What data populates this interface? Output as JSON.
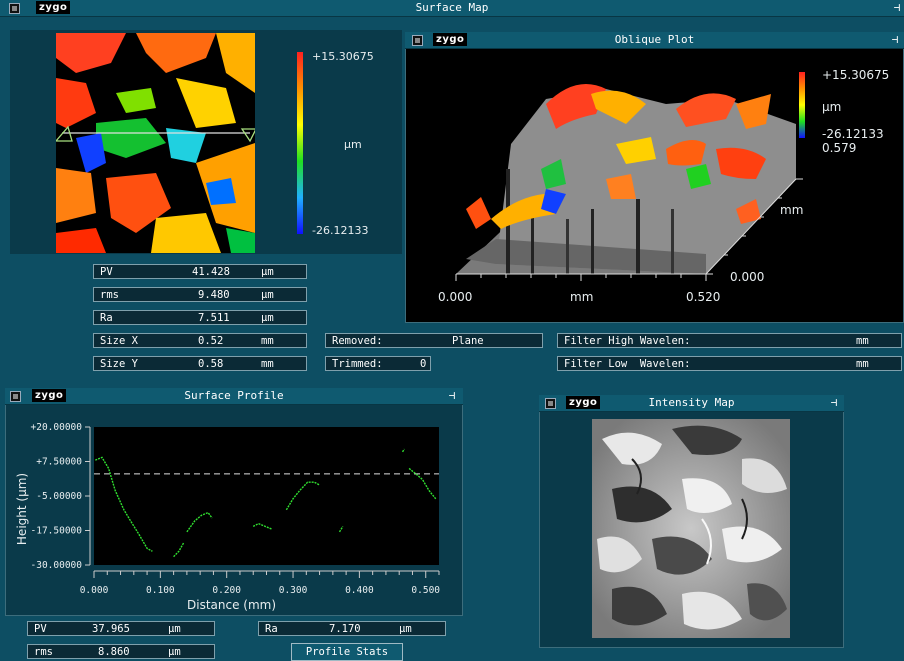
{
  "surface_map": {
    "title": "Surface Map",
    "logo": "zygo",
    "scale_max": "+15.30675",
    "scale_unit": "µm",
    "scale_min": "-26.12133",
    "stats": [
      {
        "label": "PV",
        "value": "41.428",
        "unit": "µm"
      },
      {
        "label": "rms",
        "value": "9.480",
        "unit": "µm"
      },
      {
        "label": "Ra",
        "value": "7.511",
        "unit": "µm"
      },
      {
        "label": "Size X",
        "value": "0.52",
        "unit": "mm"
      },
      {
        "label": "Size Y",
        "value": "0.58",
        "unit": "mm"
      }
    ],
    "removed_label": "Removed:",
    "removed_value": "Plane",
    "trimmed_label": "Trimmed:",
    "trimmed_value": "0",
    "filter_high_label": "Filter High Wavelen:",
    "filter_high_unit": "mm",
    "filter_low_label": "Filter Low  Wavelen:",
    "filter_low_unit": "mm"
  },
  "oblique_plot": {
    "title": "Oblique Plot",
    "logo": "zygo",
    "scale_max": "+15.30675",
    "scale_unit": "µm",
    "scale_min": "-26.12133",
    "y_max": "0.579",
    "y_unit": "mm",
    "y_zero": "0.000",
    "x_min": "0.000",
    "x_unit": "mm",
    "x_max": "0.520"
  },
  "surface_profile": {
    "title": "Surface Profile",
    "logo": "zygo",
    "stats": [
      {
        "label": "PV",
        "value": "37.965",
        "unit": "µm"
      },
      {
        "label": "rms",
        "value": "8.860",
        "unit": "µm"
      }
    ],
    "ra": {
      "label": "Ra",
      "value": "7.170",
      "unit": "µm"
    },
    "profile_stats_button": "Profile Stats"
  },
  "intensity_map": {
    "title": "Intensity Map",
    "logo": "zygo"
  },
  "chart_data": {
    "type": "line",
    "xlabel": "Distance (mm)",
    "ylabel": "Height (µm)",
    "xlim": [
      0,
      0.52
    ],
    "ylim": [
      -30,
      20
    ],
    "x_ticks": [
      "0.000",
      "0.100",
      "0.200",
      "0.300",
      "0.400",
      "0.500"
    ],
    "y_ticks": [
      "+20.00000",
      "+7.50000",
      "-5.00000",
      "-17.50000",
      "-30.00000"
    ],
    "mean_line": 3,
    "series": [
      {
        "segments": [
          [
            [
              0.002,
              8
            ],
            [
              0.012,
              9
            ],
            [
              0.022,
              5
            ],
            [
              0.032,
              -3
            ],
            [
              0.045,
              -10
            ],
            [
              0.055,
              -14
            ],
            [
              0.068,
              -19
            ],
            [
              0.08,
              -24
            ],
            [
              0.088,
              -25
            ]
          ],
          [
            [
              0.12,
              -27
            ],
            [
              0.128,
              -25
            ],
            [
              0.135,
              -22
            ]
          ],
          [
            [
              0.14,
              -18
            ],
            [
              0.152,
              -14
            ],
            [
              0.162,
              -12
            ],
            [
              0.172,
              -11
            ],
            [
              0.178,
              -13
            ]
          ],
          [
            [
              0.24,
              -16
            ],
            [
              0.248,
              -15
            ],
            [
              0.258,
              -16
            ],
            [
              0.268,
              -17
            ]
          ],
          [
            [
              0.29,
              -10
            ],
            [
              0.3,
              -6
            ],
            [
              0.31,
              -3
            ],
            [
              0.322,
              0
            ],
            [
              0.332,
              0
            ],
            [
              0.34,
              -1
            ]
          ],
          [
            [
              0.37,
              -18
            ],
            [
              0.375,
              -16
            ]
          ],
          [
            [
              0.465,
              11
            ],
            [
              0.468,
              12
            ]
          ],
          [
            [
              0.475,
              5
            ],
            [
              0.485,
              3
            ],
            [
              0.495,
              1
            ],
            [
              0.505,
              -3
            ],
            [
              0.515,
              -6
            ]
          ]
        ]
      }
    ]
  }
}
